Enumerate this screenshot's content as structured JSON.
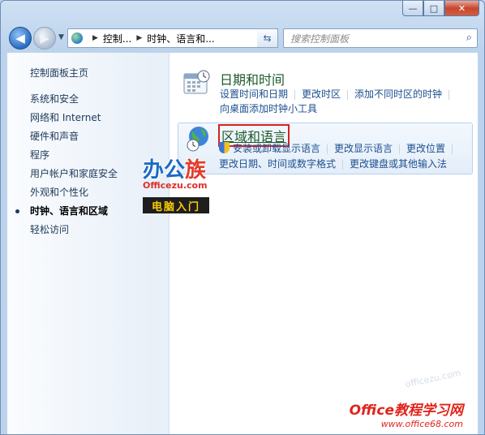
{
  "window": {
    "caption": {
      "minimize": "—",
      "maximize": "□",
      "close": "✕"
    }
  },
  "nav": {
    "back_icon": "back-arrow-icon",
    "forward_icon": "forward-arrow-icon",
    "address": {
      "crumb1": "控制...",
      "crumb2": "时钟、语言和..."
    },
    "search_placeholder": "搜索控制面板"
  },
  "sidebar": {
    "home": "控制面板主页",
    "items": [
      {
        "label": "系统和安全"
      },
      {
        "label": "网络和 Internet"
      },
      {
        "label": "硬件和声音"
      },
      {
        "label": "程序"
      },
      {
        "label": "用户帐户和家庭安全"
      },
      {
        "label": "外观和个性化"
      },
      {
        "label": "时钟、语言和区域",
        "current": true
      },
      {
        "label": "轻松访问"
      }
    ]
  },
  "main": {
    "datetime": {
      "title": "日期和时间",
      "links": [
        "设置时间和日期",
        "更改时区",
        "添加不同时区的时钟",
        "向桌面添加时钟小工具"
      ]
    },
    "region": {
      "title": "区域和语言",
      "links": [
        "安装或卸载显示语言",
        "更改显示语言",
        "更改位置",
        "更改日期、时间或数字格式",
        "更改键盘或其他输入法"
      ]
    }
  },
  "watermarks": {
    "logo_text_a": "办公",
    "logo_text_b": "族",
    "logo_url": "Officezu.com",
    "logo_tag": "电脑入门",
    "corner_title": "Office教程学习网",
    "corner_url": "www.office68.com",
    "corner_faint": "officezu.com"
  },
  "colors": {
    "link": "#1c4f8f",
    "category_title": "#1e5a2a",
    "highlight_box": "#d9201f"
  }
}
